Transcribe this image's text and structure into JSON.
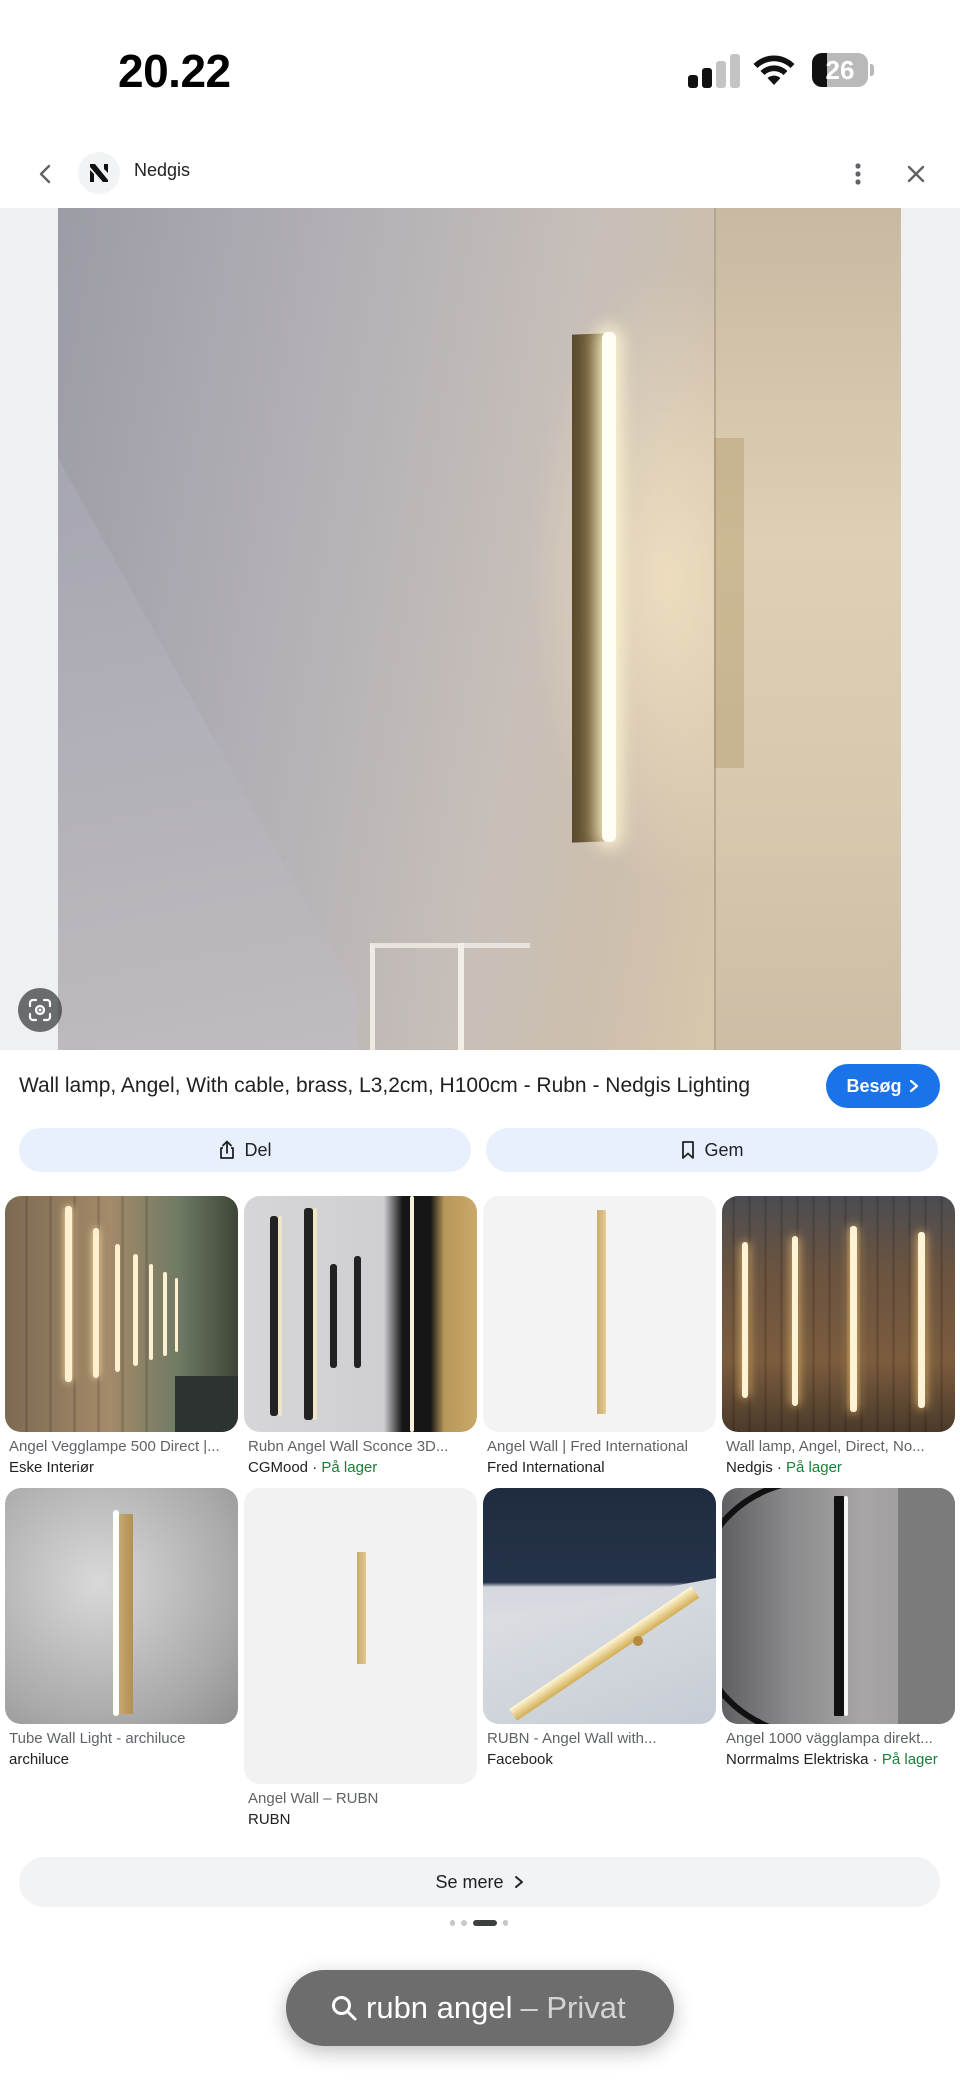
{
  "status_bar": {
    "time": "20.22",
    "battery": "26",
    "battery_level": 0.26
  },
  "header": {
    "site_name": "Nedgis"
  },
  "result": {
    "title": "Wall lamp, Angel, With cable, brass, L3,2cm, H100cm - Rubn - Nedgis Lighting",
    "visit_label": "Besøg",
    "share_label": "Del",
    "save_label": "Gem"
  },
  "related": [
    {
      "title": "Angel Vegglampe 500 Direct |...",
      "source": "Eske Interiør",
      "stock": ""
    },
    {
      "title": "Rubn Angel Wall Sconce 3D...",
      "source": "CGMood",
      "stock": "På lager"
    },
    {
      "title": "Angel Wall | Fred International",
      "source": "Fred International",
      "stock": ""
    },
    {
      "title": "Wall lamp, Angel, Direct, No...",
      "source": "Nedgis",
      "stock": "På lager"
    },
    {
      "title": "Tube Wall Light - archiluce",
      "source": "archiluce",
      "stock": ""
    },
    {
      "title": "Angel Wall – RUBN",
      "source": "RUBN",
      "stock": ""
    },
    {
      "title": "RUBN - Angel Wall with...",
      "source": "Facebook",
      "stock": ""
    },
    {
      "title": "Angel 1000 vägglampa direkt...",
      "source": "Norrmalms Elektriska",
      "stock": "På lager"
    }
  ],
  "see_more_label": "Se mere",
  "search_bar": {
    "query": "rubn angel",
    "mode": "– Privat"
  },
  "colors": {
    "accent": "#1a73e8",
    "in_stock": "#188038",
    "chip_bg": "#e8f0fe"
  }
}
